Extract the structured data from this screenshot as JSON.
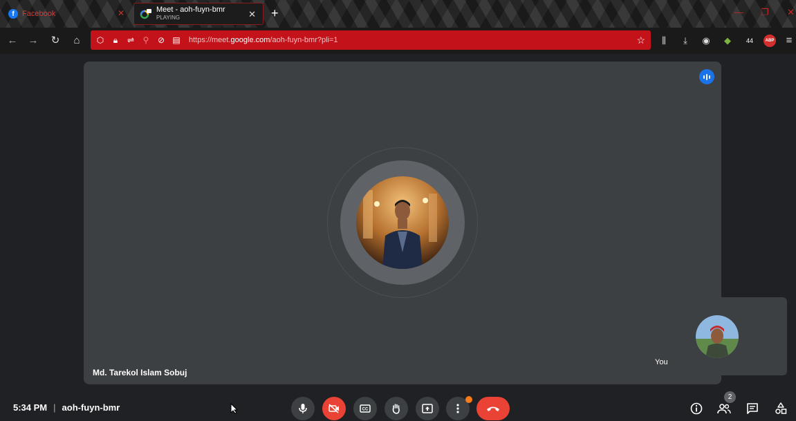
{
  "browser": {
    "tabs": [
      {
        "title": "Facebook",
        "subtitle": ""
      },
      {
        "title": "Meet - aoh-fuyn-bmr",
        "subtitle": "PLAYING"
      }
    ],
    "url_prefix": "https://meet.",
    "url_domain": "google.com",
    "url_path": "/aoh-fuyn-bmr?pli=1",
    "extension_badge": "44",
    "abp_label": "ABP"
  },
  "meeting": {
    "main_participant": "Md. Tarekol Islam Sobuj",
    "self_label": "You",
    "time": "5:34 PM",
    "code": "aoh-fuyn-bmr",
    "separator": "|",
    "participant_count": "2"
  },
  "colors": {
    "accent_blue": "#1a73e8",
    "hangup_red": "#ea4335",
    "tile_bg": "#3c4043",
    "url_bar_red": "#c4121a"
  },
  "icons": {
    "mic": "microphone-icon",
    "camera_off": "camera-off-icon",
    "captions": "captions-icon",
    "raise_hand": "raise-hand-icon",
    "present": "present-screen-icon",
    "more": "more-options-icon",
    "hangup": "hang-up-icon",
    "info": "info-icon",
    "people": "people-icon",
    "chat": "chat-icon",
    "activities": "activities-icon"
  }
}
